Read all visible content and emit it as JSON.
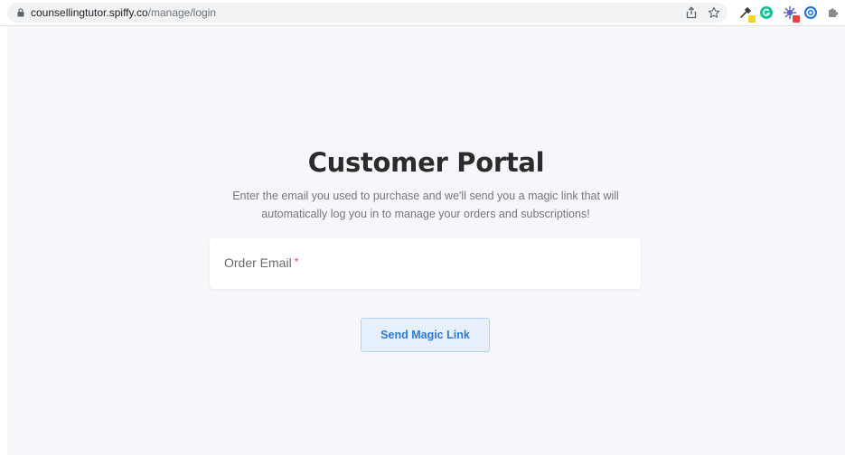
{
  "browser": {
    "url_host": "counsellingtutor.spiffy.co",
    "url_path": "/manage/login"
  },
  "portal": {
    "title": "Customer Portal",
    "subtitle": "Enter the email you used to purchase and we'll send you a magic link that will automatically log you in to manage your orders and subscriptions!",
    "email_label": "Order Email",
    "required_marker": "*",
    "email_value": "",
    "submit_label": "Send Magic Link"
  },
  "icons": {
    "address_bar": [
      "lock-icon",
      "share-icon",
      "star-icon"
    ],
    "extensions": [
      "eyedropper-icon",
      "grammarly-icon",
      "bug-extension-icon",
      "blue-circle-extension-icon",
      "puzzle-icon"
    ]
  },
  "colors": {
    "page_background": "#f5f7fb",
    "title": "#2b2b2b",
    "accent": "#2f78d9",
    "button_background": "#e6f0fc",
    "required": "#e5484d",
    "grammarly": "#15c39a",
    "badge_red": "#e8453c",
    "badge_yellow": "#f7d51c"
  }
}
